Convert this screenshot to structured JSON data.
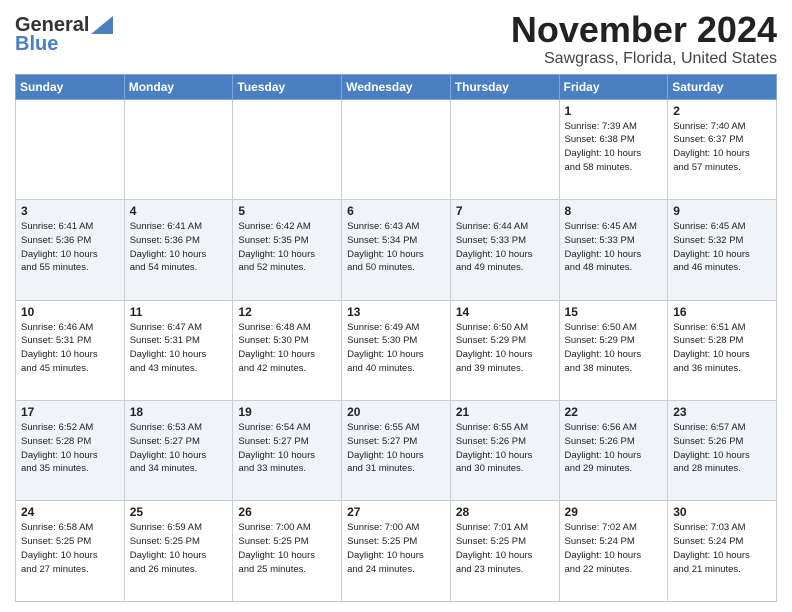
{
  "logo": {
    "line1": "General",
    "line2": "Blue"
  },
  "title": "November 2024",
  "subtitle": "Sawgrass, Florida, United States",
  "days_of_week": [
    "Sunday",
    "Monday",
    "Tuesday",
    "Wednesday",
    "Thursday",
    "Friday",
    "Saturday"
  ],
  "weeks": [
    [
      {
        "day": "",
        "info": ""
      },
      {
        "day": "",
        "info": ""
      },
      {
        "day": "",
        "info": ""
      },
      {
        "day": "",
        "info": ""
      },
      {
        "day": "",
        "info": ""
      },
      {
        "day": "1",
        "info": "Sunrise: 7:39 AM\nSunset: 6:38 PM\nDaylight: 10 hours\nand 58 minutes."
      },
      {
        "day": "2",
        "info": "Sunrise: 7:40 AM\nSunset: 6:37 PM\nDaylight: 10 hours\nand 57 minutes."
      }
    ],
    [
      {
        "day": "3",
        "info": "Sunrise: 6:41 AM\nSunset: 5:36 PM\nDaylight: 10 hours\nand 55 minutes."
      },
      {
        "day": "4",
        "info": "Sunrise: 6:41 AM\nSunset: 5:36 PM\nDaylight: 10 hours\nand 54 minutes."
      },
      {
        "day": "5",
        "info": "Sunrise: 6:42 AM\nSunset: 5:35 PM\nDaylight: 10 hours\nand 52 minutes."
      },
      {
        "day": "6",
        "info": "Sunrise: 6:43 AM\nSunset: 5:34 PM\nDaylight: 10 hours\nand 50 minutes."
      },
      {
        "day": "7",
        "info": "Sunrise: 6:44 AM\nSunset: 5:33 PM\nDaylight: 10 hours\nand 49 minutes."
      },
      {
        "day": "8",
        "info": "Sunrise: 6:45 AM\nSunset: 5:33 PM\nDaylight: 10 hours\nand 48 minutes."
      },
      {
        "day": "9",
        "info": "Sunrise: 6:45 AM\nSunset: 5:32 PM\nDaylight: 10 hours\nand 46 minutes."
      }
    ],
    [
      {
        "day": "10",
        "info": "Sunrise: 6:46 AM\nSunset: 5:31 PM\nDaylight: 10 hours\nand 45 minutes."
      },
      {
        "day": "11",
        "info": "Sunrise: 6:47 AM\nSunset: 5:31 PM\nDaylight: 10 hours\nand 43 minutes."
      },
      {
        "day": "12",
        "info": "Sunrise: 6:48 AM\nSunset: 5:30 PM\nDaylight: 10 hours\nand 42 minutes."
      },
      {
        "day": "13",
        "info": "Sunrise: 6:49 AM\nSunset: 5:30 PM\nDaylight: 10 hours\nand 40 minutes."
      },
      {
        "day": "14",
        "info": "Sunrise: 6:50 AM\nSunset: 5:29 PM\nDaylight: 10 hours\nand 39 minutes."
      },
      {
        "day": "15",
        "info": "Sunrise: 6:50 AM\nSunset: 5:29 PM\nDaylight: 10 hours\nand 38 minutes."
      },
      {
        "day": "16",
        "info": "Sunrise: 6:51 AM\nSunset: 5:28 PM\nDaylight: 10 hours\nand 36 minutes."
      }
    ],
    [
      {
        "day": "17",
        "info": "Sunrise: 6:52 AM\nSunset: 5:28 PM\nDaylight: 10 hours\nand 35 minutes."
      },
      {
        "day": "18",
        "info": "Sunrise: 6:53 AM\nSunset: 5:27 PM\nDaylight: 10 hours\nand 34 minutes."
      },
      {
        "day": "19",
        "info": "Sunrise: 6:54 AM\nSunset: 5:27 PM\nDaylight: 10 hours\nand 33 minutes."
      },
      {
        "day": "20",
        "info": "Sunrise: 6:55 AM\nSunset: 5:27 PM\nDaylight: 10 hours\nand 31 minutes."
      },
      {
        "day": "21",
        "info": "Sunrise: 6:55 AM\nSunset: 5:26 PM\nDaylight: 10 hours\nand 30 minutes."
      },
      {
        "day": "22",
        "info": "Sunrise: 6:56 AM\nSunset: 5:26 PM\nDaylight: 10 hours\nand 29 minutes."
      },
      {
        "day": "23",
        "info": "Sunrise: 6:57 AM\nSunset: 5:26 PM\nDaylight: 10 hours\nand 28 minutes."
      }
    ],
    [
      {
        "day": "24",
        "info": "Sunrise: 6:58 AM\nSunset: 5:25 PM\nDaylight: 10 hours\nand 27 minutes."
      },
      {
        "day": "25",
        "info": "Sunrise: 6:59 AM\nSunset: 5:25 PM\nDaylight: 10 hours\nand 26 minutes."
      },
      {
        "day": "26",
        "info": "Sunrise: 7:00 AM\nSunset: 5:25 PM\nDaylight: 10 hours\nand 25 minutes."
      },
      {
        "day": "27",
        "info": "Sunrise: 7:00 AM\nSunset: 5:25 PM\nDaylight: 10 hours\nand 24 minutes."
      },
      {
        "day": "28",
        "info": "Sunrise: 7:01 AM\nSunset: 5:25 PM\nDaylight: 10 hours\nand 23 minutes."
      },
      {
        "day": "29",
        "info": "Sunrise: 7:02 AM\nSunset: 5:24 PM\nDaylight: 10 hours\nand 22 minutes."
      },
      {
        "day": "30",
        "info": "Sunrise: 7:03 AM\nSunset: 5:24 PM\nDaylight: 10 hours\nand 21 minutes."
      }
    ]
  ]
}
